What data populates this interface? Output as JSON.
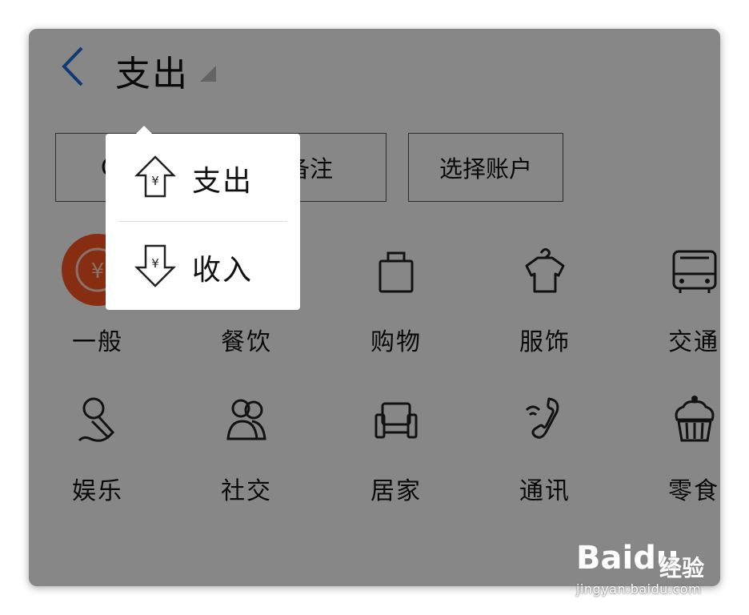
{
  "header": {
    "title": "支出",
    "back_icon": "chevron-left-icon",
    "caret_icon": "triangle-down-icon"
  },
  "chips": {
    "left_partial": "C",
    "note": "备注",
    "account": "选择账户"
  },
  "categories": [
    {
      "label": "一般",
      "icon": "yen-circle-icon"
    },
    {
      "label": "餐饮",
      "icon": "dining-icon"
    },
    {
      "label": "购物",
      "icon": "shopping-bag-icon"
    },
    {
      "label": "服饰",
      "icon": "clothes-hanger-icon"
    },
    {
      "label": "交通",
      "icon": "bus-icon"
    },
    {
      "label": "娱乐",
      "icon": "microphone-icon"
    },
    {
      "label": "社交",
      "icon": "people-icon"
    },
    {
      "label": "居家",
      "icon": "sofa-icon"
    },
    {
      "label": "通讯",
      "icon": "phone-icon"
    },
    {
      "label": "零食",
      "icon": "cupcake-icon"
    }
  ],
  "popup_menu": {
    "items": [
      {
        "label": "支出",
        "icon": "yen-up-arrow-icon"
      },
      {
        "label": "收入",
        "icon": "yen-down-arrow-icon"
      }
    ]
  },
  "watermark": {
    "brand": "Baidu",
    "product": "经验",
    "url": "jingyan.baidu.com"
  },
  "colors": {
    "accent": "#1e6fd9",
    "general_icon_bg": "#ff5722",
    "overlay": "rgba(0,0,0,0.47)"
  }
}
